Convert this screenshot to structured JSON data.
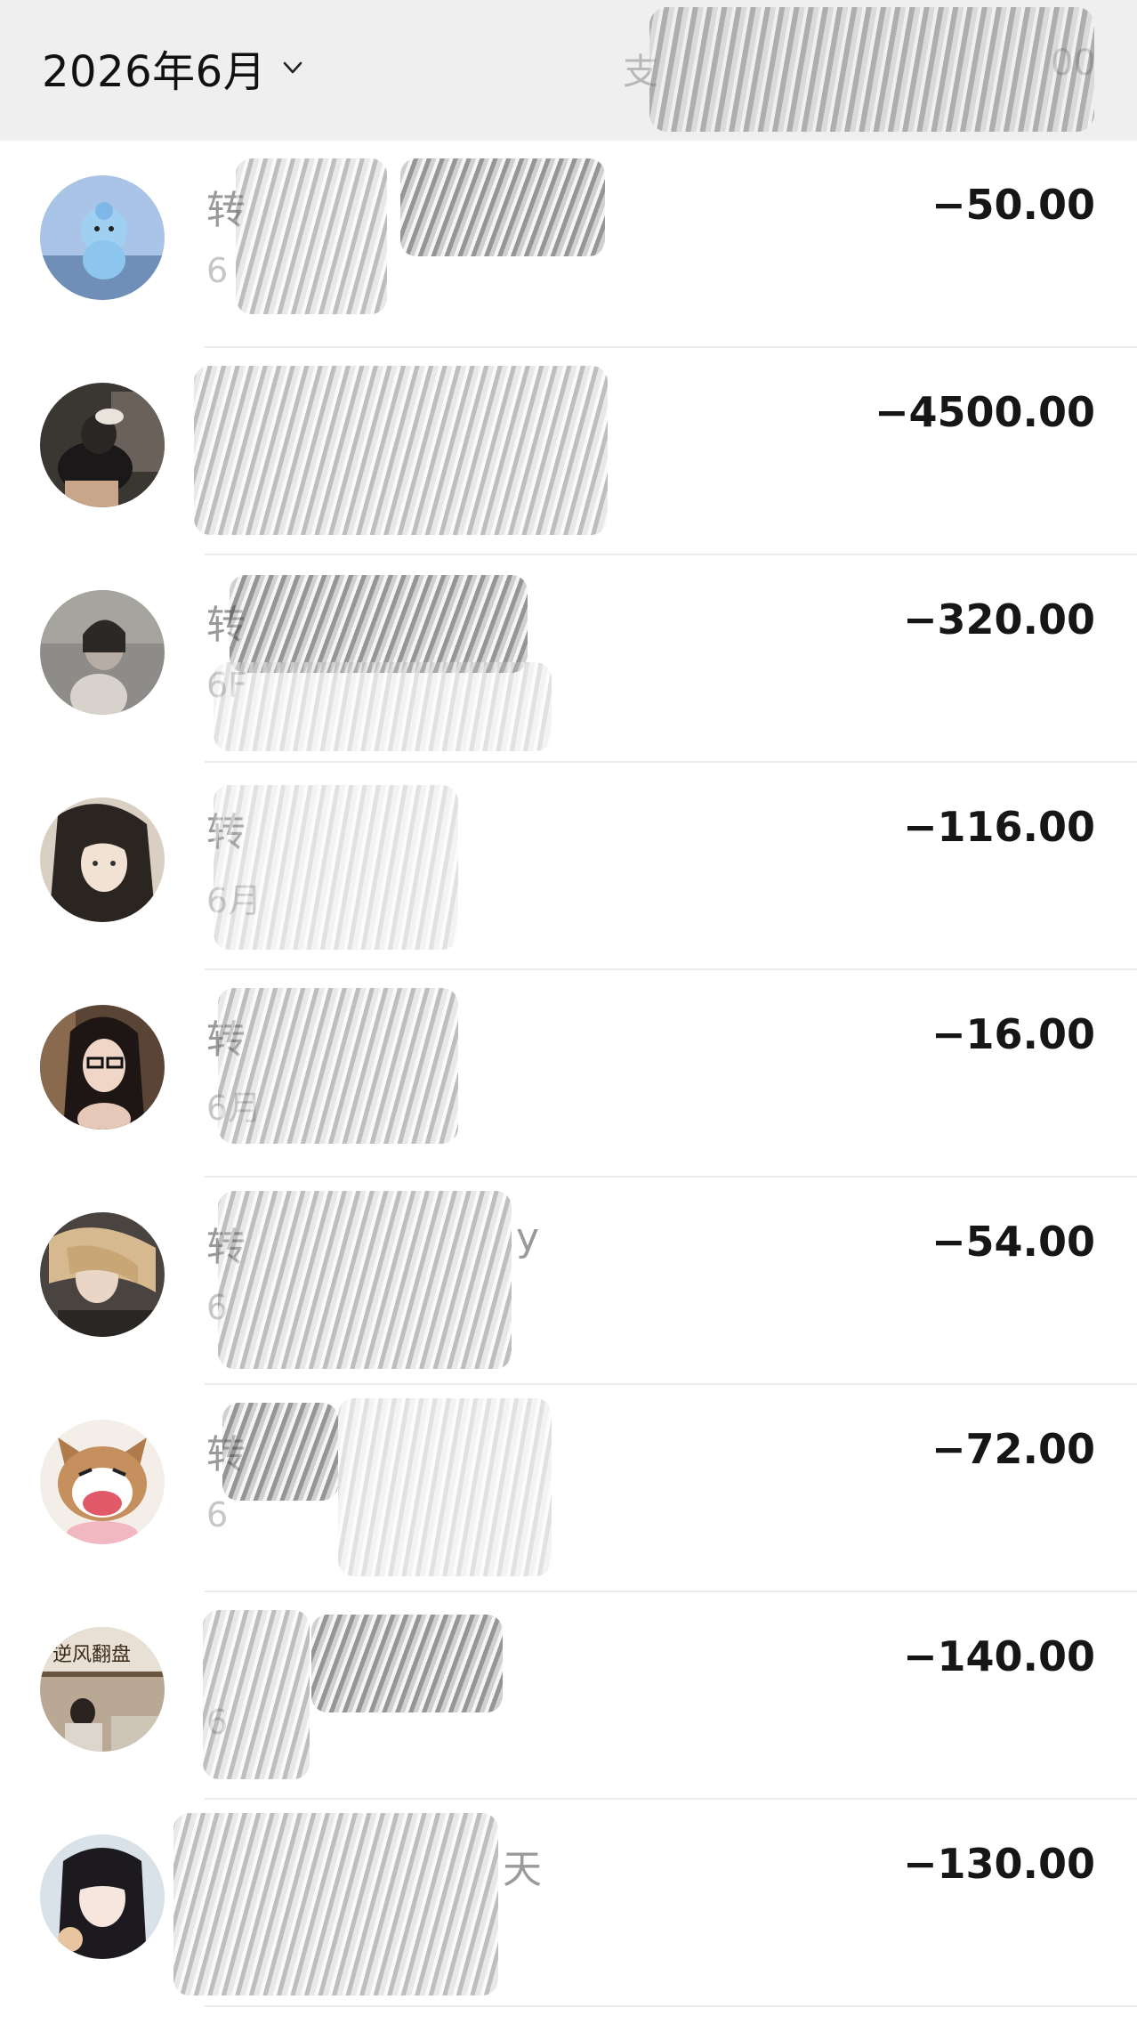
{
  "header": {
    "month": "2026年6月",
    "summary": "支",
    "summary_tail": "00"
  },
  "transactions": [
    {
      "title": "转",
      "subtitle": "6",
      "amount": "−50.00",
      "avatar": "blue-toy-avatar"
    },
    {
      "title": "",
      "subtitle": "",
      "amount": "−4500.00",
      "avatar": "cat-person-avatar"
    },
    {
      "title": "转",
      "subtitle": "6F",
      "amount": "−320.00",
      "avatar": "gray-portrait-avatar"
    },
    {
      "title": "转",
      "subtitle": "6月",
      "amount": "−116.00",
      "avatar": "girl-hair-avatar"
    },
    {
      "title": "转",
      "subtitle": "6月",
      "amount": "−16.00",
      "avatar": "glasses-girl-avatar"
    },
    {
      "title": "转",
      "title_tail": "y",
      "subtitle": "6",
      "amount": "−54.00",
      "avatar": "blonde-girl-avatar"
    },
    {
      "title": "转",
      "subtitle": "6",
      "amount": "−72.00",
      "avatar": "cartoon-cat-avatar"
    },
    {
      "title": "",
      "subtitle": "6",
      "amount": "−140.00",
      "avatar": "sign-scene-avatar"
    },
    {
      "title": "",
      "title_tail": "天",
      "subtitle": "",
      "amount": "−130.00",
      "avatar": "dark-hair-girl-avatar"
    }
  ],
  "colors": {
    "header_bg": "#efefef",
    "amount_text": "#161616",
    "muted_text": "#9a9a9a"
  }
}
